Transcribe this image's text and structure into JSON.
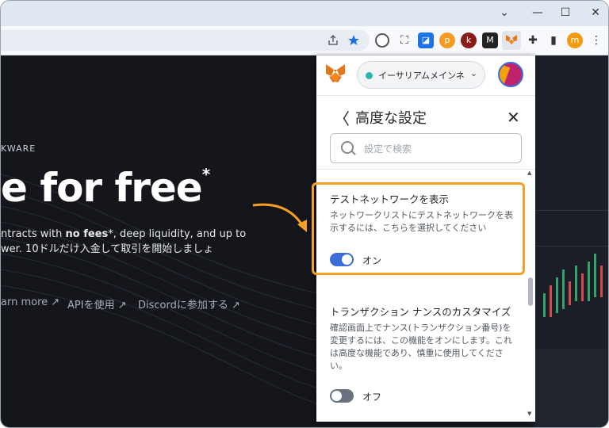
{
  "browser": {
    "window_controls": {
      "minimize": "—",
      "maximize": "☐",
      "close": "✕"
    },
    "toolbar_profile_initial": "m"
  },
  "webpage": {
    "eyebrow": "KWARE",
    "hero": "e for free",
    "hero_sup": "*",
    "desc_line1_pre": "ntracts with ",
    "desc_line1_bold": "no fees",
    "desc_line1_post": "*, deep liquidity, and up to",
    "desc_line2": "wer. 10ドルだけ入金して取引を開始しましょ",
    "links": [
      "arn more ↗",
      "APIを使用 ↗",
      "Discordに参加する ↗"
    ]
  },
  "metamask": {
    "network_label": "イーサリアムメインネッ...",
    "page_title": "高度な設定",
    "search_placeholder": "設定で検索",
    "settings": [
      {
        "title": "テストネットワークを表示",
        "description": "ネットワークリストにテストネットワークを表示するには、こちらを選択してください",
        "state_label": "オン",
        "enabled": true
      },
      {
        "title": "トランザクション ナンスのカスタマイズ",
        "description": "確認画面上でナンス(トランザクション番号)を変更するには、この機能をオンにします。これは高度な機能であり、慎重に使用してください。",
        "state_label": "オフ",
        "enabled": false
      }
    ]
  },
  "colors": {
    "highlight": "#f5a024",
    "toggle_on": "#3c6dd8",
    "toggle_off": "#6a737d",
    "network_dot": "#29b6af"
  }
}
